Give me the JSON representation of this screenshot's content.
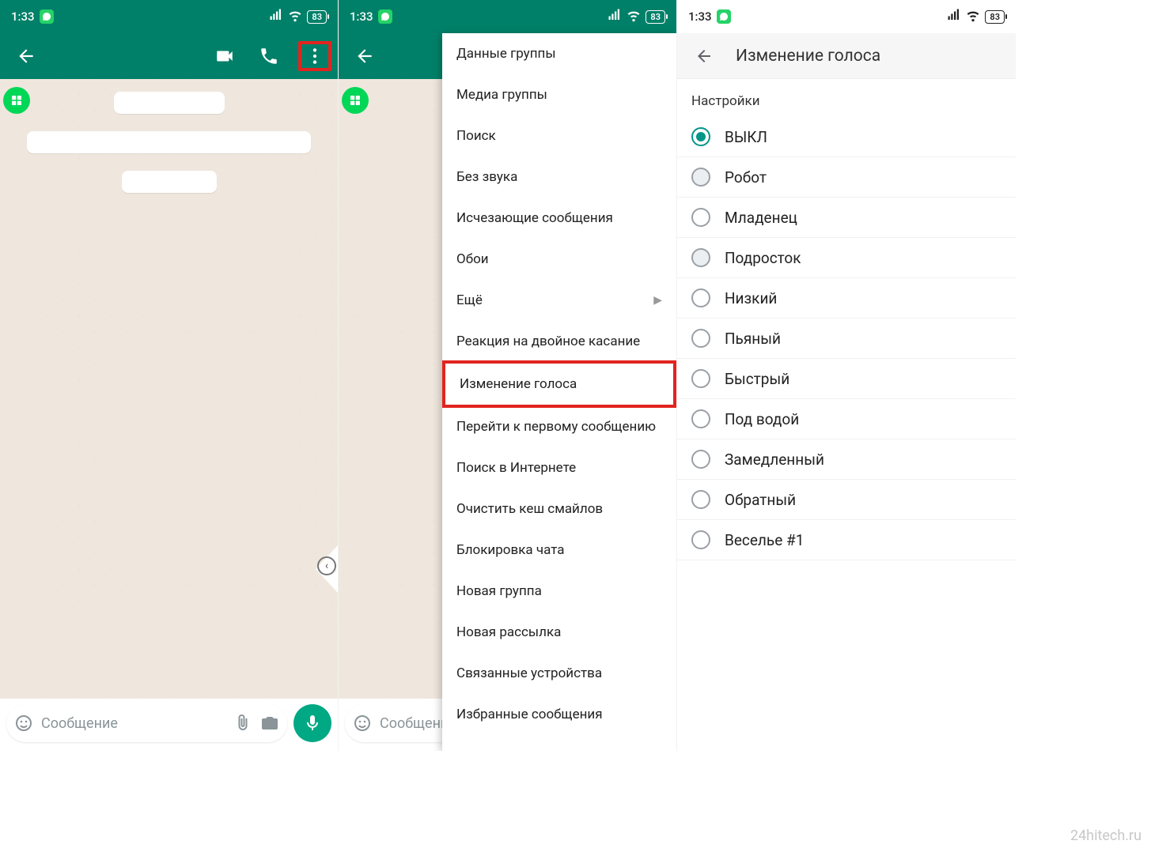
{
  "status": {
    "time": "1:33",
    "battery": "83"
  },
  "compose": {
    "placeholder": "Сообщение"
  },
  "menu": {
    "items": [
      "Данные группы",
      "Медиа группы",
      "Поиск",
      "Без звука",
      "Исчезающие сообщения",
      "Обои",
      "Ещё",
      "Реакция на двойное касание",
      "Изменение голоса",
      "Перейти к первому сообщению",
      "Поиск в Интернете",
      "Очистить кеш смайлов",
      "Блокировка чата",
      "Новая группа",
      "Новая рассылка",
      "Связанные устройства",
      "Избранные сообщения"
    ],
    "submenu_index": 6,
    "highlighted_index": 8
  },
  "settings": {
    "title": "Изменение голоса",
    "section": "Настройки",
    "options": [
      {
        "label": "ВЫКЛ",
        "selected": true
      },
      {
        "label": "Робот",
        "bg": true
      },
      {
        "label": "Младенец"
      },
      {
        "label": "Подросток",
        "bg": true
      },
      {
        "label": "Низкий"
      },
      {
        "label": "Пьяный"
      },
      {
        "label": "Быстрый"
      },
      {
        "label": "Под водой"
      },
      {
        "label": "Замедленный"
      },
      {
        "label": "Обратный"
      },
      {
        "label": "Веселье #1"
      }
    ]
  },
  "watermark": "24hitech.ru"
}
